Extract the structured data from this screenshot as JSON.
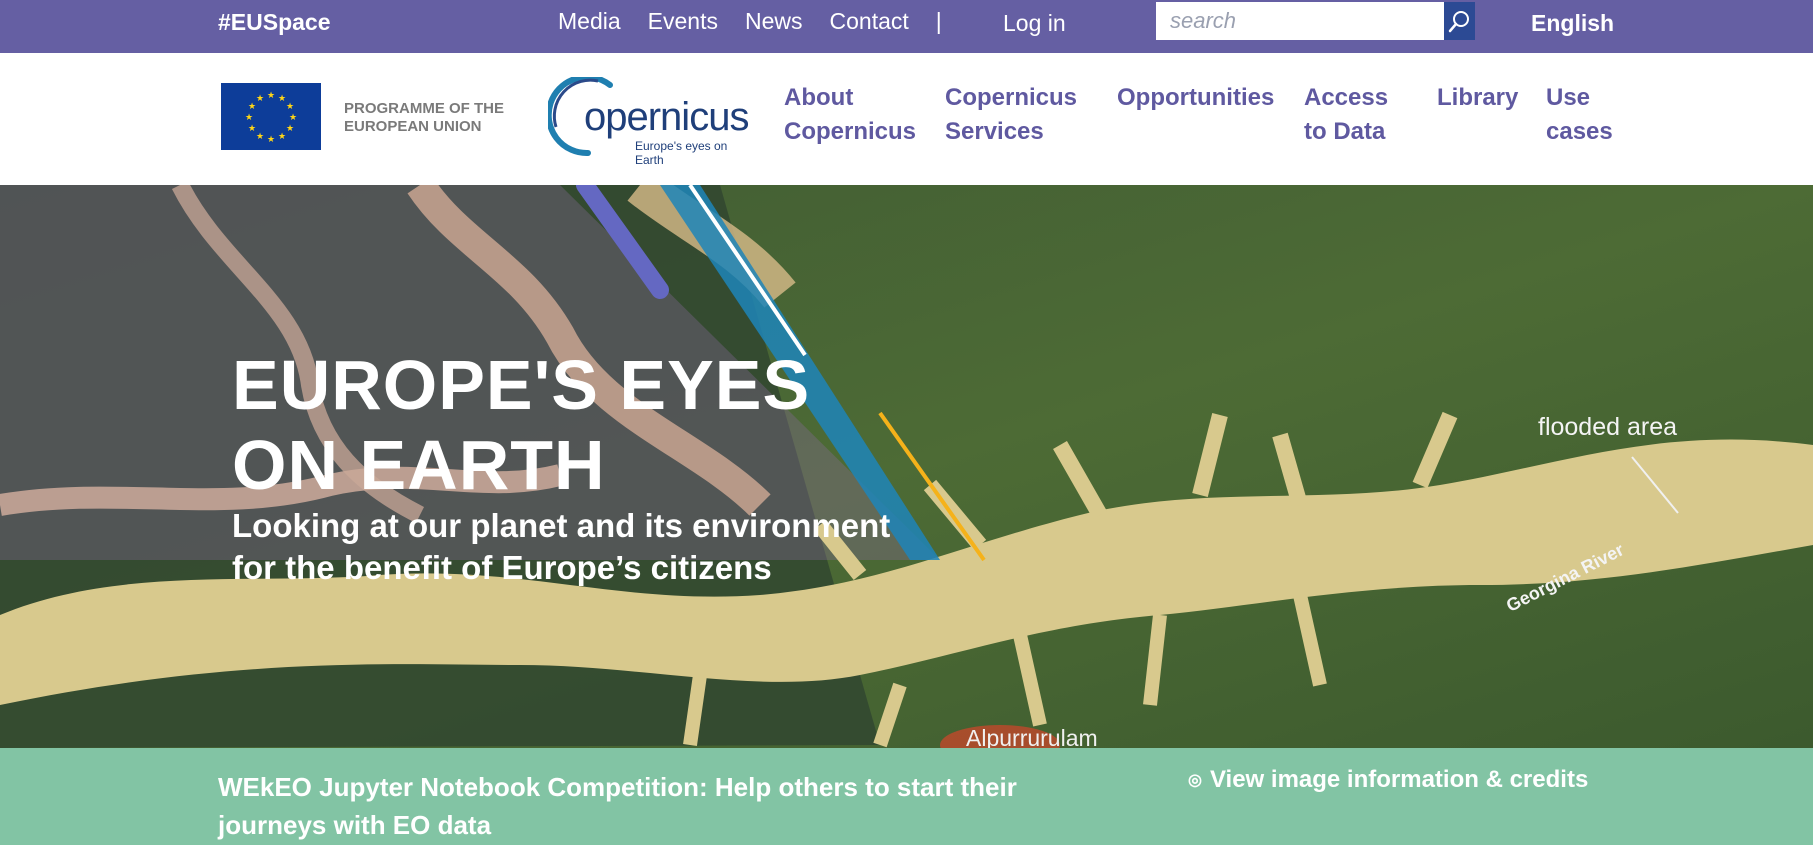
{
  "topbar": {
    "hashtag": "#EUSpace",
    "links": [
      "Media",
      "Events",
      "News",
      "Contact"
    ],
    "separator": "|",
    "login": "Log in",
    "search_placeholder": "search",
    "language": "English"
  },
  "header": {
    "eu_programme_line1": "PROGRAMME OF THE",
    "eu_programme_line2": "EUROPEAN UNION",
    "logo_word": "opernicus",
    "logo_tagline": "Europe's eyes on Earth",
    "nav": [
      {
        "line1": "About",
        "line2": "Copernicus"
      },
      {
        "line1": "Copernicus",
        "line2": "Services"
      },
      {
        "line1": "Opportunities",
        "line2": ""
      },
      {
        "line1": "Access",
        "line2": "to Data"
      },
      {
        "line1": "Library",
        "line2": ""
      },
      {
        "line1": "Use",
        "line2": "cases"
      }
    ]
  },
  "hero": {
    "title_line1": "EUROPE'S EYES",
    "title_line2": "ON EARTH",
    "subtitle_line1": "Looking at our planet and its environment",
    "subtitle_line2": "for the benefit of Europe’s citizens",
    "map_label_flood": "flooded area",
    "map_label_river": "Georgina River",
    "map_label_town": "Alpurrurulam"
  },
  "banner": {
    "news_text": "WEkEO Jupyter Notebook Competition: Help others to start their journeys with EO data",
    "credits_icon": "◎",
    "credits_text": "View image information & credits"
  },
  "colors": {
    "topbar": "#655fa3",
    "nav_text": "#5f59a0",
    "banner": "#82c4a4",
    "search_button": "#2c4a94"
  }
}
